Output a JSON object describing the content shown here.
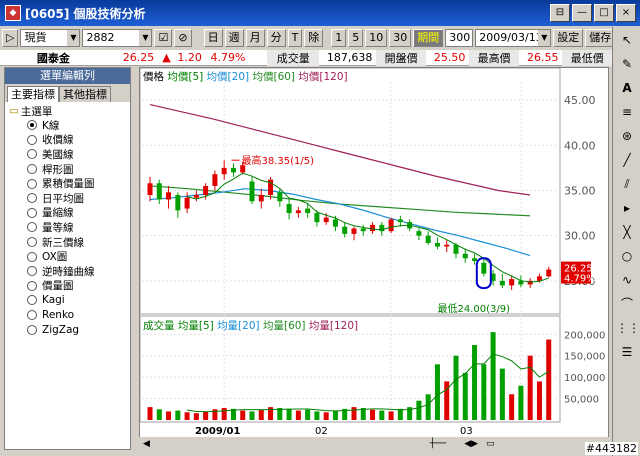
{
  "window": {
    "title": "[0605] 個股技術分析",
    "icon": "app-icon",
    "buttons": [
      "⊟",
      "—",
      "□",
      "×"
    ]
  },
  "toolbar": {
    "market": "現貨",
    "code": "2882",
    "buttons": [
      "日",
      "週",
      "月",
      "分",
      "T",
      "除"
    ],
    "periods": [
      "1",
      "5",
      "10",
      "30"
    ],
    "period_label": "期間",
    "count": "300",
    "date": "2009/03/13",
    "settings": "設定",
    "save": "儲存"
  },
  "info": {
    "name": "國泰金",
    "price": "26.25",
    "change_arrow": "▲",
    "change": "1.20",
    "pct": "4.79%",
    "vol_label": "成交量",
    "vol": "187,638",
    "open_label": "開盤價",
    "open": "25.50",
    "high_label": "最高價",
    "high": "26.55",
    "low_label": "最低價"
  },
  "sidebar": {
    "header": "選單編輯列",
    "tabs": [
      "主要指標",
      "其他指標"
    ],
    "root": "主選單",
    "items": [
      "K線",
      "收價線",
      "美國線",
      "桿形圖",
      "累積價量圖",
      "日平均圖",
      "量縮線",
      "量等線",
      "新三價線",
      "OX圖",
      "逆時鐘曲線",
      "價量圖",
      "Kagi",
      "Renko",
      "ZigZag"
    ],
    "selected": 0
  },
  "chart": {
    "price_legend": [
      "價格",
      "均價[5]",
      "均價[20]",
      "均價[60]",
      "均價[120]"
    ],
    "vol_legend": [
      "成交量",
      "均量[5]",
      "均量[20]",
      "均量[60]",
      "均量[120]"
    ],
    "price_ticks": [
      "45.00",
      "40.00",
      "35.00",
      "30.00",
      "25.00"
    ],
    "vol_ticks": [
      "200,000",
      "150,000",
      "100,000",
      "50,000"
    ],
    "x_labels": [
      "2009/01",
      "02",
      "03"
    ],
    "high_note": "最高38.35(1/5)",
    "low_note": "最低24.00(3/9)",
    "last_price": "26.25",
    "last_pct": "4.79%",
    "colors": {
      "up": "#e00000",
      "down": "#00a000",
      "ma5": "#008000",
      "ma20": "#1a8fd8",
      "ma60": "#228b22",
      "ma120": "#a0205a"
    }
  },
  "chart_data": {
    "type": "candlestick",
    "price": {
      "ylim": [
        22,
        47
      ],
      "ticks": [
        45,
        40,
        35,
        30,
        25
      ]
    },
    "candles": [
      [
        34.5,
        36.5,
        33.8,
        35.8
      ],
      [
        35.8,
        36.2,
        33.5,
        34.0
      ],
      [
        34.0,
        35.5,
        33.0,
        34.8
      ],
      [
        34.5,
        34.8,
        32.0,
        32.8
      ],
      [
        33.0,
        34.8,
        32.5,
        34.2
      ],
      [
        34.2,
        35.0,
        33.8,
        34.5
      ],
      [
        34.5,
        35.8,
        34.0,
        35.5
      ],
      [
        35.5,
        37.2,
        35.0,
        36.8
      ],
      [
        36.8,
        38.35,
        36.2,
        37.5
      ],
      [
        37.5,
        38.0,
        36.5,
        37.0
      ],
      [
        37.0,
        38.2,
        36.8,
        37.8
      ],
      [
        36.0,
        36.5,
        33.5,
        33.8
      ],
      [
        33.8,
        35.2,
        33.0,
        34.5
      ],
      [
        34.5,
        36.5,
        34.0,
        36.2
      ],
      [
        34.8,
        35.2,
        33.2,
        33.8
      ],
      [
        33.5,
        34.0,
        31.8,
        32.5
      ],
      [
        32.5,
        33.2,
        32.0,
        32.8
      ],
      [
        33.0,
        33.5,
        32.0,
        32.5
      ],
      [
        32.5,
        32.8,
        31.0,
        31.5
      ],
      [
        31.5,
        32.5,
        31.2,
        32.0
      ],
      [
        31.8,
        32.2,
        30.5,
        31.0
      ],
      [
        31.0,
        31.5,
        29.8,
        30.2
      ],
      [
        30.2,
        31.0,
        29.5,
        30.8
      ],
      [
        30.8,
        31.2,
        30.0,
        30.5
      ],
      [
        30.5,
        31.5,
        30.2,
        31.2
      ],
      [
        31.2,
        31.5,
        30.0,
        30.5
      ],
      [
        30.5,
        32.0,
        30.3,
        31.8
      ],
      [
        31.8,
        32.2,
        31.0,
        31.5
      ],
      [
        31.5,
        31.8,
        30.5,
        30.8
      ],
      [
        30.5,
        30.8,
        29.5,
        30.0
      ],
      [
        30.0,
        30.5,
        29.0,
        29.2
      ],
      [
        29.2,
        29.8,
        28.5,
        28.8
      ],
      [
        28.8,
        29.5,
        28.2,
        29.0
      ],
      [
        29.0,
        29.2,
        27.5,
        28.0
      ],
      [
        28.0,
        28.5,
        27.0,
        27.5
      ],
      [
        27.5,
        28.0,
        26.8,
        27.2
      ],
      [
        27.0,
        27.5,
        25.5,
        25.8
      ],
      [
        25.8,
        26.2,
        24.5,
        25.0
      ],
      [
        25.0,
        25.8,
        24.2,
        24.5
      ],
      [
        24.5,
        25.5,
        24.0,
        25.2
      ],
      [
        25.0,
        25.6,
        24.3,
        24.6
      ],
      [
        24.6,
        25.3,
        24.2,
        25.0
      ],
      [
        25.0,
        25.8,
        24.8,
        25.5
      ],
      [
        25.5,
        26.55,
        25.4,
        26.25
      ]
    ],
    "ma20": [
      34.0,
      34.2,
      34.5,
      34.8,
      35.2,
      35.0,
      34.6,
      34.0,
      33.5,
      32.8,
      32.0,
      31.3,
      30.6,
      30.0,
      29.3,
      28.6,
      27.8
    ],
    "ma60": [
      35.5,
      35.2,
      34.8,
      34.4,
      33.9,
      33.5,
      33.2,
      32.9,
      32.6,
      32.4,
      32.2
    ],
    "ma120": [
      44.5,
      43.7,
      42.9,
      42.0,
      41.1,
      40.2,
      39.3,
      38.4,
      37.5,
      36.6,
      35.8,
      35.0,
      34.5
    ],
    "volume": {
      "ylim": [
        0,
        210000
      ],
      "ticks": [
        200000,
        150000,
        100000,
        50000
      ],
      "values": [
        30000,
        25000,
        20000,
        22000,
        18000,
        16000,
        20000,
        25000,
        28000,
        26000,
        22000,
        20000,
        24000,
        30000,
        28000,
        25000,
        22000,
        24000,
        20000,
        18000,
        22000,
        26000,
        30000,
        28000,
        24000,
        22000,
        20000,
        26000,
        30000,
        45000,
        60000,
        130000,
        90000,
        150000,
        110000,
        175000,
        130000,
        205000,
        120000,
        60000,
        80000,
        150000,
        90000,
        187638
      ]
    }
  }
}
